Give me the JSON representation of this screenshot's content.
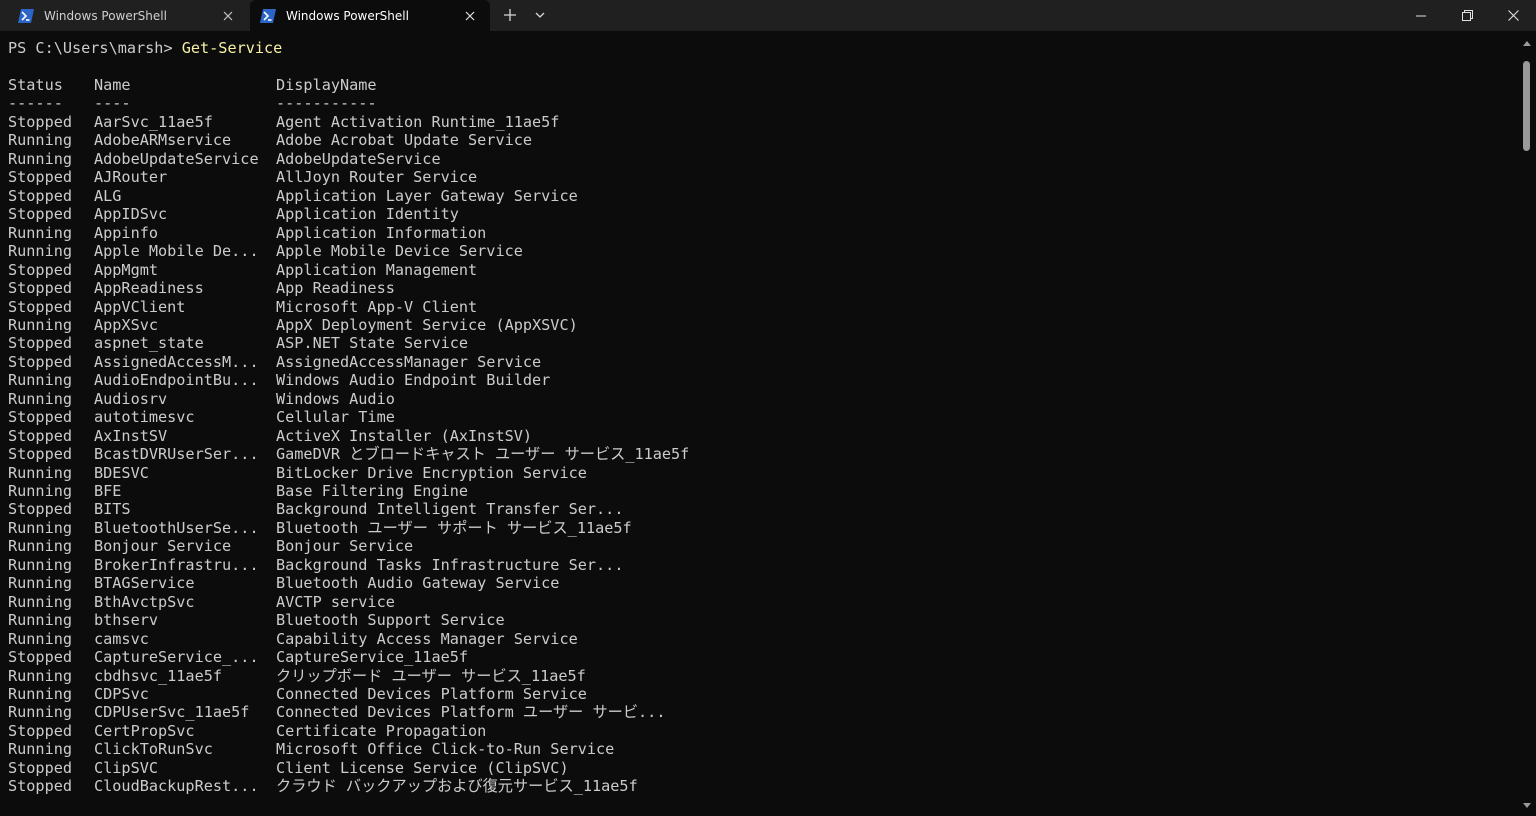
{
  "tabs": [
    {
      "title": "Windows PowerShell",
      "icon": "powershell-icon",
      "active": false
    },
    {
      "title": "Windows PowerShell",
      "icon": "powershell-icon",
      "active": true
    }
  ],
  "tab_controls": {
    "close_glyph": "✕",
    "new_tab_glyph": "+",
    "dropdown_glyph": "⌄"
  },
  "window_controls": {
    "minimize": "minimize-icon",
    "maximize": "restore-icon",
    "close": "close-icon"
  },
  "terminal": {
    "prompt": "PS C:\\Users\\marsh> ",
    "command": "Get-Service",
    "headers": {
      "status": "Status",
      "name": "Name",
      "display_name": "DisplayName"
    },
    "underlines": {
      "status": "------",
      "name": "----",
      "display_name": "-----------"
    },
    "rows": [
      {
        "status": "Stopped",
        "name": "AarSvc_11ae5f",
        "display_name": "Agent Activation Runtime_11ae5f"
      },
      {
        "status": "Running",
        "name": "AdobeARMservice",
        "display_name": "Adobe Acrobat Update Service"
      },
      {
        "status": "Running",
        "name": "AdobeUpdateService",
        "display_name": "AdobeUpdateService"
      },
      {
        "status": "Stopped",
        "name": "AJRouter",
        "display_name": "AllJoyn Router Service"
      },
      {
        "status": "Stopped",
        "name": "ALG",
        "display_name": "Application Layer Gateway Service"
      },
      {
        "status": "Stopped",
        "name": "AppIDSvc",
        "display_name": "Application Identity"
      },
      {
        "status": "Running",
        "name": "Appinfo",
        "display_name": "Application Information"
      },
      {
        "status": "Running",
        "name": "Apple Mobile De...",
        "display_name": "Apple Mobile Device Service"
      },
      {
        "status": "Stopped",
        "name": "AppMgmt",
        "display_name": "Application Management"
      },
      {
        "status": "Stopped",
        "name": "AppReadiness",
        "display_name": "App Readiness"
      },
      {
        "status": "Stopped",
        "name": "AppVClient",
        "display_name": "Microsoft App-V Client"
      },
      {
        "status": "Running",
        "name": "AppXSvc",
        "display_name": "AppX Deployment Service (AppXSVC)"
      },
      {
        "status": "Stopped",
        "name": "aspnet_state",
        "display_name": "ASP.NET State Service"
      },
      {
        "status": "Stopped",
        "name": "AssignedAccessM...",
        "display_name": "AssignedAccessManager Service"
      },
      {
        "status": "Running",
        "name": "AudioEndpointBu...",
        "display_name": "Windows Audio Endpoint Builder"
      },
      {
        "status": "Running",
        "name": "Audiosrv",
        "display_name": "Windows Audio"
      },
      {
        "status": "Stopped",
        "name": "autotimesvc",
        "display_name": "Cellular Time"
      },
      {
        "status": "Stopped",
        "name": "AxInstSV",
        "display_name": "ActiveX Installer (AxInstSV)"
      },
      {
        "status": "Stopped",
        "name": "BcastDVRUserSer...",
        "display_name": "GameDVR とブロードキャスト ユーザー サービス_11ae5f"
      },
      {
        "status": "Running",
        "name": "BDESVC",
        "display_name": "BitLocker Drive Encryption Service"
      },
      {
        "status": "Running",
        "name": "BFE",
        "display_name": "Base Filtering Engine"
      },
      {
        "status": "Stopped",
        "name": "BITS",
        "display_name": "Background Intelligent Transfer Ser..."
      },
      {
        "status": "Running",
        "name": "BluetoothUserSe...",
        "display_name": "Bluetooth ユーザー サポート サービス_11ae5f"
      },
      {
        "status": "Running",
        "name": "Bonjour Service",
        "display_name": "Bonjour Service"
      },
      {
        "status": "Running",
        "name": "BrokerInfrastru...",
        "display_name": "Background Tasks Infrastructure Ser..."
      },
      {
        "status": "Running",
        "name": "BTAGService",
        "display_name": "Bluetooth Audio Gateway Service"
      },
      {
        "status": "Running",
        "name": "BthAvctpSvc",
        "display_name": "AVCTP service"
      },
      {
        "status": "Running",
        "name": "bthserv",
        "display_name": "Bluetooth Support Service"
      },
      {
        "status": "Running",
        "name": "camsvc",
        "display_name": "Capability Access Manager Service"
      },
      {
        "status": "Stopped",
        "name": "CaptureService_...",
        "display_name": "CaptureService_11ae5f"
      },
      {
        "status": "Running",
        "name": "cbdhsvc_11ae5f",
        "display_name": "クリップボード ユーザー サービス_11ae5f"
      },
      {
        "status": "Running",
        "name": "CDPSvc",
        "display_name": "Connected Devices Platform Service"
      },
      {
        "status": "Running",
        "name": "CDPUserSvc_11ae5f",
        "display_name": "Connected Devices Platform ユーザー サービ..."
      },
      {
        "status": "Stopped",
        "name": "CertPropSvc",
        "display_name": "Certificate Propagation"
      },
      {
        "status": "Running",
        "name": "ClickToRunSvc",
        "display_name": "Microsoft Office Click-to-Run Service"
      },
      {
        "status": "Stopped",
        "name": "ClipSVC",
        "display_name": "Client License Service (ClipSVC)"
      },
      {
        "status": "Stopped",
        "name": "CloudBackupRest...",
        "display_name": "クラウド バックアップおよび復元サービス_11ae5f"
      }
    ]
  },
  "colors": {
    "background": "#0c0c0c",
    "text": "#cccccc",
    "command": "#f9f1a5",
    "titlebar": "#202020"
  }
}
